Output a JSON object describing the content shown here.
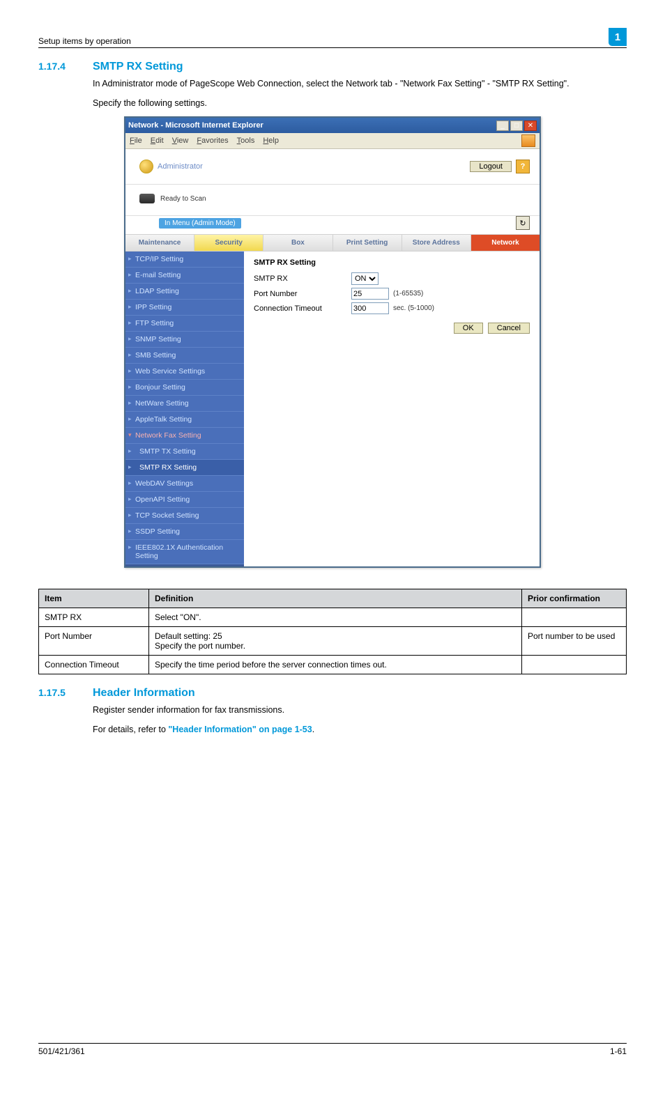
{
  "corner_badge": "1",
  "top_header": "Setup items by operation",
  "section1": {
    "num": "1.17.4",
    "title": "SMTP RX Setting",
    "para1": "In Administrator mode of PageScope Web Connection, select the Network tab - \"Network Fax Setting\" - \"SMTP RX Setting\".",
    "para2": "Specify the following settings."
  },
  "screenshot": {
    "window_title": "Network - Microsoft Internet Explorer",
    "menus": [
      "File",
      "Edit",
      "View",
      "Favorites",
      "Tools",
      "Help"
    ],
    "admin_label": "Administrator",
    "logout": "Logout",
    "help": "?",
    "ready": "Ready to Scan",
    "mode_banner": "In Menu (Admin Mode)",
    "tabs": [
      "Maintenance",
      "Security",
      "Box",
      "Print Setting",
      "Store Address",
      "Network"
    ],
    "sidebar": [
      "TCP/IP Setting",
      "E-mail Setting",
      "LDAP Setting",
      "IPP Setting",
      "FTP Setting",
      "SNMP Setting",
      "SMB Setting",
      "Web Service Settings",
      "Bonjour Setting",
      "NetWare Setting",
      "AppleTalk Setting",
      "Network Fax Setting",
      "SMTP TX Setting",
      "SMTP RX Setting",
      "WebDAV Settings",
      "OpenAPI Setting",
      "TCP Socket Setting",
      "SSDP Setting",
      "IEEE802.1X Authentication Setting"
    ],
    "pane_title": "SMTP RX Setting",
    "form": {
      "smtprx_label": "SMTP RX",
      "smtprx_value": "ON",
      "port_label": "Port Number",
      "port_value": "25",
      "port_hint": "(1-65535)",
      "timeout_label": "Connection Timeout",
      "timeout_value": "300",
      "timeout_hint": "sec. (5-1000)"
    },
    "ok": "OK",
    "cancel": "Cancel"
  },
  "deftable": {
    "headers": [
      "Item",
      "Definition",
      "Prior confirmation"
    ],
    "rows": [
      {
        "item": "SMTP RX",
        "def": "Select \"ON\".",
        "prior": ""
      },
      {
        "item": "Port Number",
        "def": "Default setting: 25\nSpecify the port number.",
        "prior": "Port number to be used"
      },
      {
        "item": "Connection Timeout",
        "def": "Specify the time period before the server connection times out.",
        "prior": ""
      }
    ]
  },
  "section2": {
    "num": "1.17.5",
    "title": "Header Information",
    "para1": "Register sender information for fax transmissions.",
    "para2_prefix": "For details, refer to ",
    "para2_link": "\"Header Information\" on page 1-53",
    "para2_suffix": "."
  },
  "footer": {
    "left": "501/421/361",
    "right": "1-61"
  }
}
